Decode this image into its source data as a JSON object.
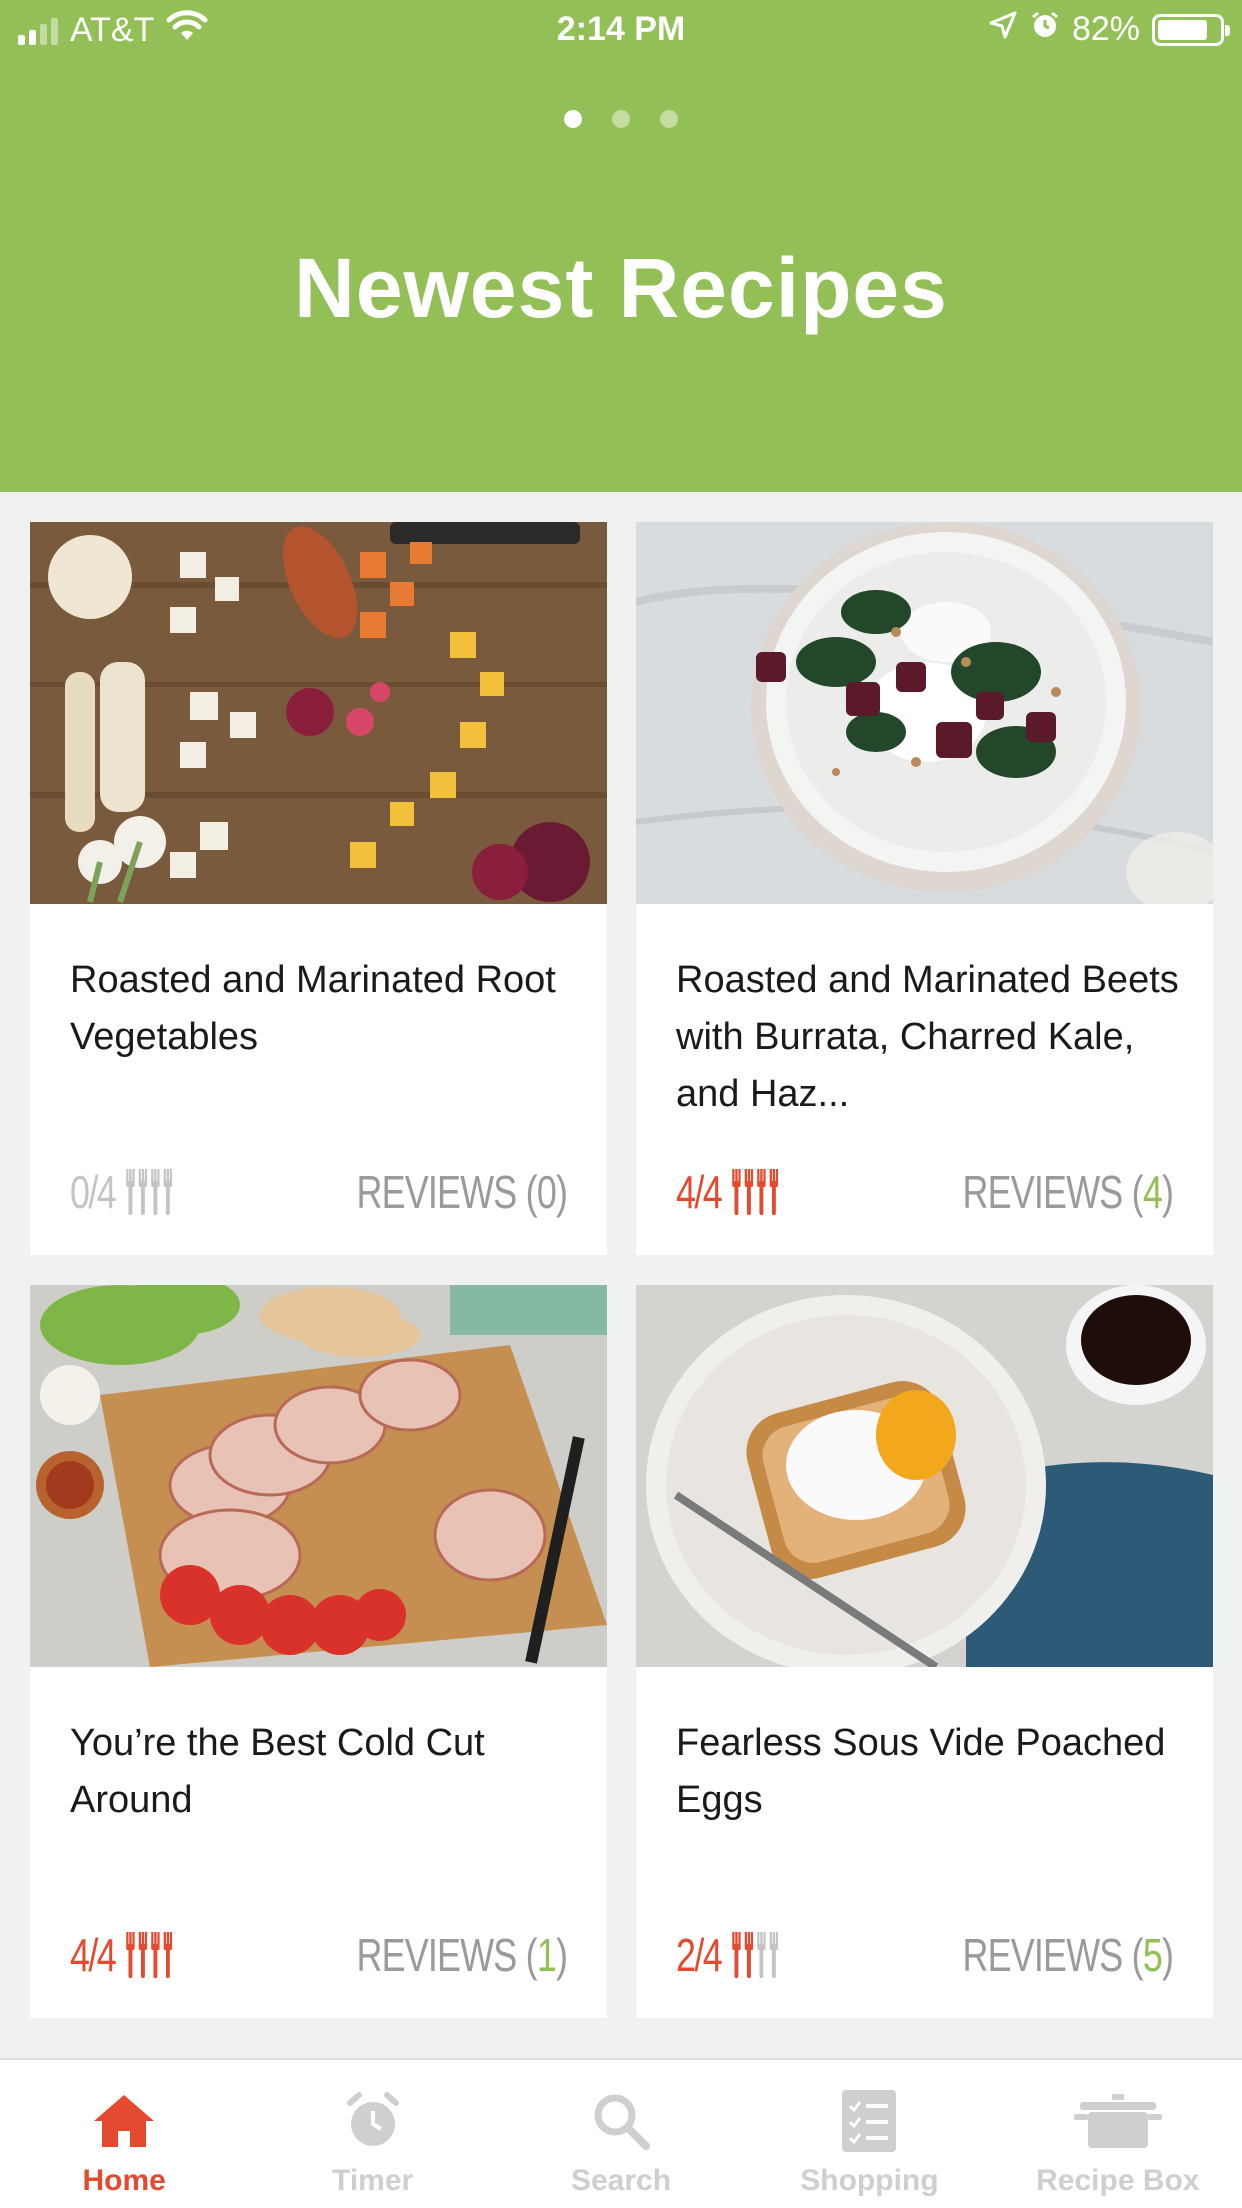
{
  "status_bar": {
    "carrier": "AT&T",
    "time": "2:14 PM",
    "battery": "82%",
    "battery_level": 0.82
  },
  "header": {
    "title": "Newest Recipes",
    "page_count": 3,
    "active_page": 0
  },
  "colors": {
    "brand_green": "#93bf57",
    "accent_red": "#e34a2f",
    "muted_gray": "#9a9a9a"
  },
  "cards": [
    {
      "title": "Roasted and Marinated Root Vegetables",
      "rating": "0/4",
      "rating_value": 0,
      "reviews_label": "REVIEWS (",
      "reviews_count": "0",
      "reviews_close": ")",
      "image": "root-vegetables-photo"
    },
    {
      "title": "Roasted and Marinated Beets with Burrata, Charred Kale, and Haz...",
      "rating": "4/4",
      "rating_value": 4,
      "reviews_label": "REVIEWS (",
      "reviews_count": "4",
      "reviews_close": ")",
      "image": "beets-burrata-plate-photo"
    },
    {
      "title": "You’re the Best Cold Cut Around",
      "rating": "4/4",
      "rating_value": 4,
      "reviews_label": "REVIEWS (",
      "reviews_count": "1",
      "reviews_close": ")",
      "image": "cold-cut-board-photo"
    },
    {
      "title": "Fearless Sous Vide Poached Eggs",
      "rating": "2/4",
      "rating_value": 2,
      "reviews_label": "REVIEWS (",
      "reviews_count": "5",
      "reviews_close": ")",
      "image": "poached-egg-toast-photo"
    }
  ],
  "tabs": [
    {
      "label": "Home",
      "icon": "home-icon",
      "active": true
    },
    {
      "label": "Timer",
      "icon": "alarm-clock-icon",
      "active": false
    },
    {
      "label": "Search",
      "icon": "search-icon",
      "active": false
    },
    {
      "label": "Shopping",
      "icon": "checklist-icon",
      "active": false
    },
    {
      "label": "Recipe Box",
      "icon": "pot-icon",
      "active": false
    }
  ]
}
